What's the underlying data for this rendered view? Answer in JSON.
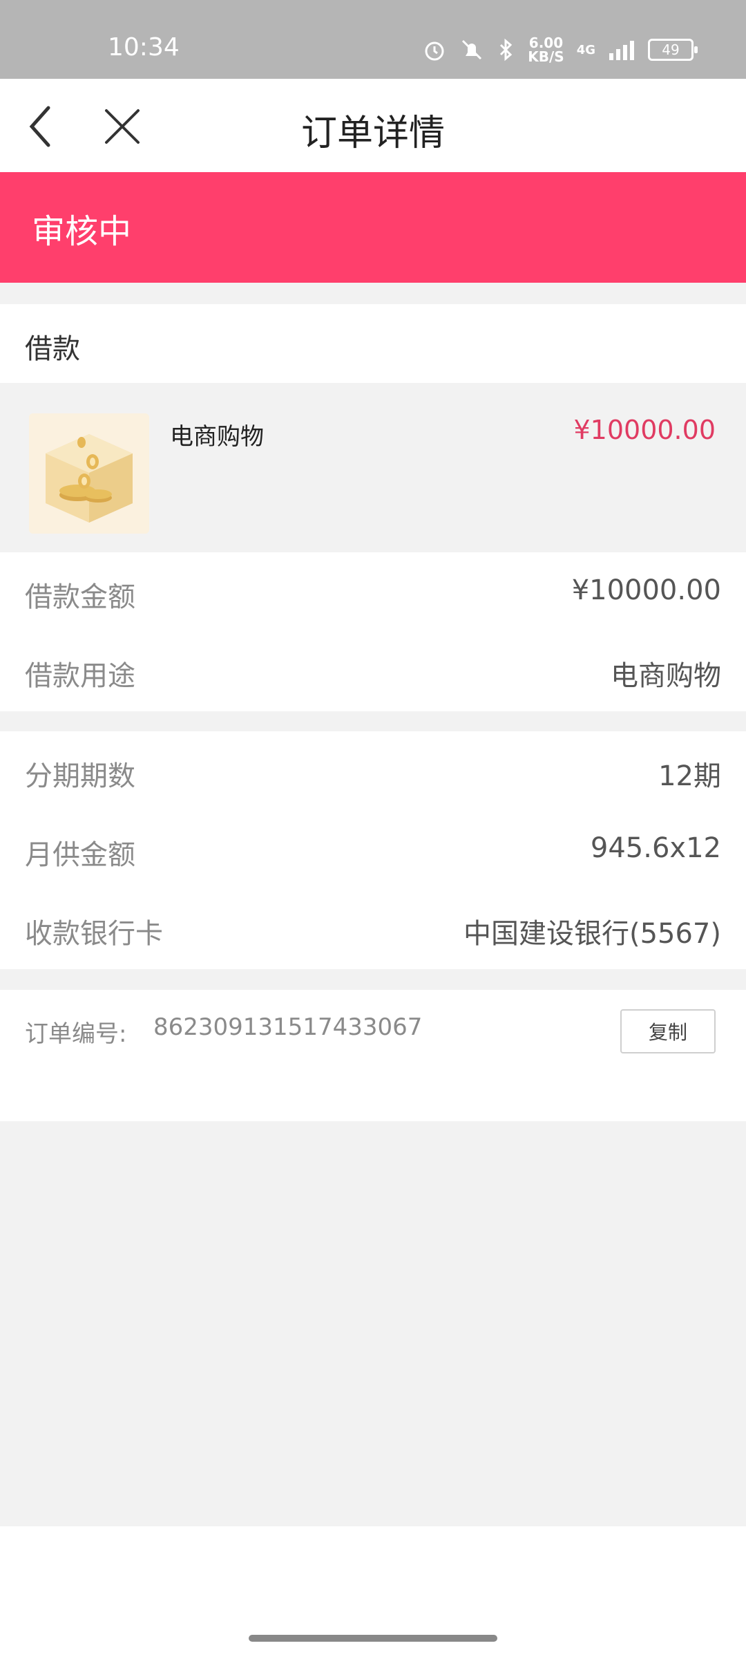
{
  "status_bar": {
    "time": "10:34",
    "speed_value": "6.00",
    "speed_unit": "KB/S",
    "network": "4G",
    "battery": "49"
  },
  "header": {
    "title": "订单详情"
  },
  "status_banner": {
    "text": "审核中",
    "color": "#ff3f6c"
  },
  "section": {
    "title": "借款"
  },
  "product": {
    "name": "电商购物",
    "price": "¥10000.00"
  },
  "loan_details": [
    {
      "label": "借款金额",
      "value": "¥10000.00"
    },
    {
      "label": "借款用途",
      "value": "电商购物"
    }
  ],
  "installment_details": [
    {
      "label": "分期期数",
      "value": "12期"
    },
    {
      "label": "月供金额",
      "value": "945.6x12"
    },
    {
      "label": "收款银行卡",
      "value": "中国建设银行(5567)"
    }
  ],
  "order": {
    "label": "订单编号:",
    "number": "862309131517433067",
    "copy_label": "复制"
  }
}
